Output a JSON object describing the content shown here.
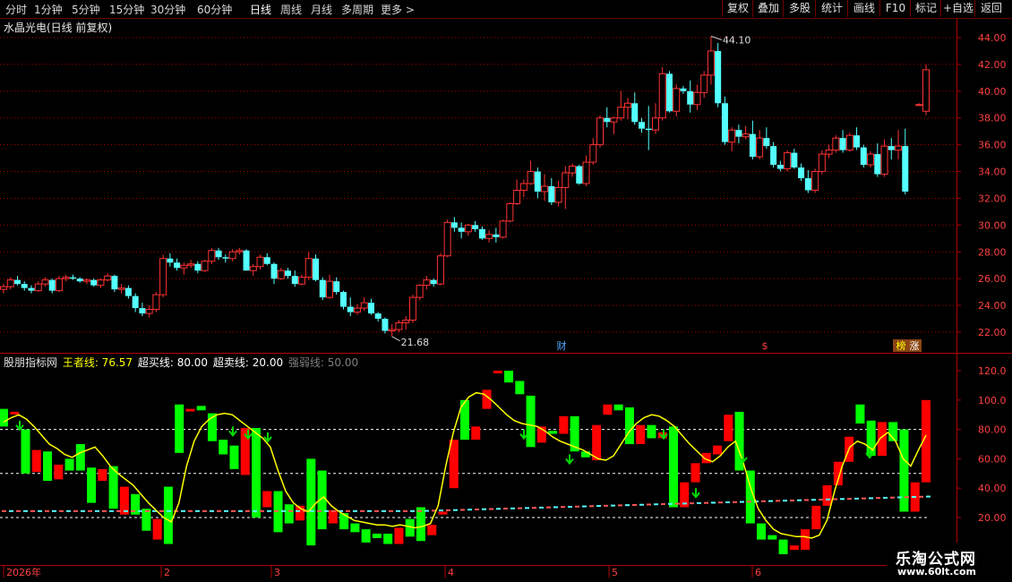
{
  "toolbar": {
    "periods": [
      "分时",
      "1分钟",
      "5分钟",
      "15分钟",
      "30分钟",
      "60分钟",
      "日线",
      "周线",
      "月线",
      "多周期",
      "更多 >"
    ],
    "active_period": "日线",
    "tools": [
      "复权",
      "叠加",
      "多股",
      "统计",
      "画线",
      "F10",
      "标记",
      "+自选",
      "返回"
    ]
  },
  "main_chart": {
    "title": "水晶光电(日线 前复权)",
    "price_axis": [
      "44.00",
      "42.00",
      "40.00",
      "38.00",
      "36.00",
      "34.00",
      "32.00",
      "30.00",
      "28.00",
      "26.00",
      "24.00",
      "22.00"
    ],
    "high_label": "44.10",
    "low_label": "21.68",
    "markers": [
      "财",
      "$",
      "榜",
      "涨"
    ]
  },
  "indicator": {
    "name": "股朋指标网",
    "lines": [
      {
        "label": "王者线:",
        "value": "76.57",
        "color": "#ffff00"
      },
      {
        "label": "超买线:",
        "value": "80.00",
        "color": "#ffffff"
      },
      {
        "label": "超卖线:",
        "value": "20.00",
        "color": "#ffffff"
      },
      {
        "label": "强弱线:",
        "value": "50.00",
        "color": "#808080"
      }
    ],
    "axis": [
      "120.0",
      "100.0",
      "80.00",
      "60.00",
      "40.00",
      "20.00"
    ]
  },
  "date_axis": [
    "2026年",
    "2",
    "3",
    "4",
    "5",
    "6"
  ],
  "watermark": {
    "line1": "乐淘公式网",
    "line2": "www.60lt.com"
  },
  "colors": {
    "up": "#ff3232",
    "down": "#54ffff",
    "ind_up": "#ff0000",
    "ind_down": "#00ff00",
    "king": "#ffff00",
    "grid": "#b00000"
  },
  "chart_data": [
    {
      "type": "candlestick",
      "title": "水晶光电(日线 前复权)",
      "ylim": [
        21.0,
        45.0
      ],
      "annotations": [
        {
          "label": "44.10",
          "type": "high"
        },
        {
          "label": "21.68",
          "type": "low"
        }
      ],
      "ohlc": [
        [
          25.2,
          25.6,
          24.9,
          25.4
        ],
        [
          25.4,
          26.1,
          25.2,
          25.9
        ],
        [
          25.9,
          26.2,
          25.5,
          25.6
        ],
        [
          25.6,
          25.8,
          25.1,
          25.3
        ],
        [
          25.3,
          25.5,
          24.9,
          25.1
        ],
        [
          25.1,
          25.8,
          25.0,
          25.6
        ],
        [
          25.6,
          26.1,
          25.4,
          25.9
        ],
        [
          25.9,
          26.0,
          24.9,
          25.1
        ],
        [
          25.1,
          26.2,
          25.0,
          26.0
        ],
        [
          26.0,
          26.3,
          25.8,
          26.1
        ],
        [
          26.1,
          26.3,
          25.9,
          26.0
        ],
        [
          26.0,
          26.1,
          25.7,
          25.8
        ],
        [
          25.8,
          26.0,
          25.6,
          25.9
        ],
        [
          25.9,
          26.0,
          25.4,
          25.5
        ],
        [
          25.5,
          26.0,
          25.3,
          25.9
        ],
        [
          25.9,
          26.4,
          25.8,
          26.2
        ],
        [
          26.2,
          26.3,
          25.0,
          25.2
        ],
        [
          25.2,
          25.6,
          24.9,
          25.3
        ],
        [
          25.3,
          25.5,
          24.5,
          24.7
        ],
        [
          24.7,
          24.9,
          23.5,
          23.8
        ],
        [
          23.8,
          24.2,
          23.2,
          23.4
        ],
        [
          23.4,
          24.0,
          23.1,
          23.7
        ],
        [
          23.7,
          25.0,
          23.5,
          24.8
        ],
        [
          24.8,
          27.8,
          24.6,
          27.5
        ],
        [
          27.5,
          27.9,
          26.9,
          27.2
        ],
        [
          27.2,
          27.5,
          26.6,
          26.8
        ],
        [
          26.8,
          27.2,
          26.3,
          27.0
        ],
        [
          27.0,
          27.4,
          26.8,
          27.1
        ],
        [
          27.1,
          27.3,
          26.4,
          26.6
        ],
        [
          26.6,
          27.4,
          26.5,
          27.3
        ],
        [
          27.3,
          28.3,
          27.1,
          28.1
        ],
        [
          28.1,
          28.3,
          27.4,
          27.6
        ],
        [
          27.6,
          27.8,
          27.2,
          27.5
        ],
        [
          27.5,
          28.2,
          27.3,
          28.0
        ],
        [
          28.0,
          28.3,
          27.8,
          28.1
        ],
        [
          28.1,
          28.2,
          26.6,
          26.6
        ],
        [
          26.6,
          27.1,
          26.2,
          26.9
        ],
        [
          26.9,
          27.8,
          26.7,
          27.6
        ],
        [
          27.6,
          27.9,
          27.0,
          27.1
        ],
        [
          27.1,
          27.2,
          25.6,
          26.0
        ],
        [
          26.0,
          26.8,
          25.9,
          26.6
        ],
        [
          26.6,
          26.8,
          26.0,
          26.2
        ],
        [
          26.2,
          26.6,
          25.4,
          25.6
        ],
        [
          25.6,
          26.3,
          25.5,
          26.1
        ],
        [
          26.1,
          28.0,
          25.9,
          27.5
        ],
        [
          27.5,
          27.8,
          25.8,
          25.9
        ],
        [
          25.9,
          26.1,
          24.4,
          24.6
        ],
        [
          24.6,
          26.3,
          24.5,
          25.8
        ],
        [
          25.8,
          26.1,
          24.8,
          25.0
        ],
        [
          25.0,
          25.1,
          23.7,
          23.9
        ],
        [
          23.9,
          24.6,
          23.2,
          23.5
        ],
        [
          23.5,
          24.1,
          23.3,
          23.8
        ],
        [
          23.8,
          24.6,
          23.6,
          24.2
        ],
        [
          24.2,
          24.5,
          23.3,
          23.4
        ],
        [
          23.4,
          23.5,
          22.8,
          23.0
        ],
        [
          23.0,
          23.1,
          21.9,
          22.1
        ],
        [
          22.1,
          22.6,
          21.68,
          22.2
        ],
        [
          22.2,
          22.9,
          22.0,
          22.7
        ],
        [
          22.7,
          23.2,
          22.2,
          22.9
        ],
        [
          22.9,
          24.8,
          22.7,
          24.6
        ],
        [
          24.6,
          25.6,
          24.4,
          25.5
        ],
        [
          25.5,
          26.2,
          25.2,
          25.9
        ],
        [
          25.9,
          26.0,
          25.4,
          25.6
        ],
        [
          25.6,
          27.9,
          25.5,
          27.7
        ],
        [
          27.7,
          30.4,
          27.6,
          30.2
        ],
        [
          30.2,
          30.6,
          29.5,
          29.8
        ],
        [
          29.8,
          30.2,
          29.0,
          29.5
        ],
        [
          29.5,
          30.1,
          29.2,
          30.0
        ],
        [
          30.0,
          30.3,
          29.5,
          29.7
        ],
        [
          29.7,
          29.9,
          28.9,
          29.0
        ],
        [
          29.0,
          29.6,
          28.7,
          29.3
        ],
        [
          29.3,
          29.8,
          28.7,
          29.1
        ],
        [
          29.1,
          30.4,
          29.0,
          30.3
        ],
        [
          30.3,
          31.7,
          30.2,
          31.6
        ],
        [
          31.6,
          33.4,
          31.5,
          32.6
        ],
        [
          32.6,
          33.4,
          32.1,
          33.1
        ],
        [
          33.1,
          34.8,
          33.0,
          34.0
        ],
        [
          34.0,
          34.3,
          32.0,
          32.5
        ],
        [
          32.5,
          33.8,
          31.8,
          32.9
        ],
        [
          32.9,
          33.5,
          31.5,
          31.7
        ],
        [
          31.7,
          33.3,
          31.4,
          32.8
        ],
        [
          32.8,
          34.4,
          31.2,
          33.9
        ],
        [
          33.9,
          34.6,
          33.6,
          34.4
        ],
        [
          34.4,
          34.5,
          33.0,
          33.1
        ],
        [
          33.1,
          35.2,
          32.9,
          34.7
        ],
        [
          34.7,
          36.5,
          34.5,
          36.0
        ],
        [
          36.0,
          38.2,
          35.8,
          38.0
        ],
        [
          38.0,
          38.8,
          37.3,
          37.7
        ],
        [
          37.7,
          38.1,
          36.8,
          38.0
        ],
        [
          38.0,
          40.0,
          37.8,
          38.8
        ],
        [
          38.8,
          39.5,
          37.9,
          39.1
        ],
        [
          39.1,
          39.9,
          37.5,
          37.7
        ],
        [
          37.7,
          38.0,
          36.9,
          37.2
        ],
        [
          37.2,
          38.9,
          35.6,
          37.1
        ],
        [
          37.1,
          39.1,
          36.8,
          38.0
        ],
        [
          38.0,
          41.8,
          37.8,
          41.3
        ],
        [
          41.3,
          41.5,
          38.4,
          38.5
        ],
        [
          38.5,
          40.5,
          38.1,
          40.2
        ],
        [
          40.2,
          40.4,
          39.8,
          40.0
        ],
        [
          40.0,
          40.8,
          38.4,
          39.0
        ],
        [
          39.0,
          40.5,
          38.6,
          39.9
        ],
        [
          39.9,
          41.5,
          39.5,
          41.2
        ],
        [
          41.2,
          44.1,
          40.5,
          43.0
        ],
        [
          43.0,
          43.6,
          38.8,
          39.1
        ],
        [
          39.1,
          39.6,
          36.0,
          36.2
        ],
        [
          36.2,
          37.3,
          35.5,
          37.1
        ],
        [
          37.1,
          37.5,
          36.1,
          36.6
        ],
        [
          36.6,
          37.4,
          36.4,
          36.8
        ],
        [
          36.8,
          37.8,
          34.9,
          35.1
        ],
        [
          35.1,
          37.1,
          34.9,
          36.5
        ],
        [
          36.5,
          37.3,
          35.7,
          35.9
        ],
        [
          35.9,
          36.2,
          34.3,
          34.5
        ],
        [
          34.5,
          34.8,
          34.0,
          34.2
        ],
        [
          34.2,
          35.6,
          34.0,
          35.4
        ],
        [
          35.4,
          35.7,
          34.2,
          34.3
        ],
        [
          34.3,
          34.6,
          33.3,
          33.5
        ],
        [
          33.5,
          34.1,
          32.4,
          32.6
        ],
        [
          32.6,
          34.2,
          32.4,
          34.0
        ],
        [
          34.0,
          35.6,
          33.8,
          35.3
        ],
        [
          35.3,
          36.0,
          35.0,
          35.6
        ],
        [
          35.6,
          36.7,
          35.4,
          36.5
        ],
        [
          36.5,
          37.1,
          35.4,
          35.6
        ],
        [
          35.6,
          36.9,
          35.5,
          36.7
        ],
        [
          36.7,
          37.3,
          35.6,
          35.8
        ],
        [
          35.8,
          36.0,
          34.3,
          34.5
        ],
        [
          34.5,
          35.5,
          34.3,
          35.3
        ],
        [
          35.3,
          36.1,
          33.6,
          33.8
        ],
        [
          33.8,
          36.4,
          33.6,
          35.9
        ],
        [
          35.9,
          36.5,
          34.9,
          35.6
        ],
        [
          35.6,
          37.1,
          34.9,
          35.9
        ],
        [
          35.9,
          37.2,
          32.3,
          32.5
        ],
        [
          null,
          null,
          null,
          null
        ],
        [
          39.0,
          39.1,
          38.9,
          39.0
        ],
        [
          38.5,
          42.0,
          38.2,
          41.6
        ]
      ]
    },
    {
      "type": "indicator",
      "title": "股朋指标网",
      "ylim": [
        10,
        125
      ],
      "series": [
        {
          "name": "王者线",
          "value": 76.57
        },
        {
          "name": "超买线",
          "value": 80.0
        },
        {
          "name": "超卖线",
          "value": 20.0
        },
        {
          "name": "强弱线",
          "value": 50.0
        }
      ],
      "king": [
        85,
        88,
        90,
        87,
        82,
        76,
        70,
        67,
        63,
        61,
        64,
        66,
        68,
        62,
        55,
        50,
        46,
        42,
        36,
        30,
        25,
        20,
        17,
        30,
        55,
        72,
        82,
        87,
        90,
        91,
        90,
        86,
        82,
        78,
        74,
        68,
        52,
        38,
        30,
        26,
        24,
        30,
        34,
        28,
        24,
        21,
        18,
        17,
        16,
        15,
        15,
        14,
        15,
        14,
        13,
        14,
        16,
        28,
        55,
        78,
        95,
        102,
        105,
        104,
        100,
        95,
        90,
        86,
        84,
        83,
        82,
        79,
        75,
        72,
        70,
        68,
        66,
        63,
        60,
        59,
        62,
        70,
        78,
        84,
        88,
        90,
        89,
        86,
        82,
        76,
        70,
        65,
        60,
        58,
        62,
        68,
        72,
        58,
        40,
        26,
        18,
        12,
        9,
        8,
        7,
        7,
        6,
        8,
        18,
        38,
        55,
        68,
        72,
        70,
        66,
        74,
        78,
        72,
        60,
        55,
        66,
        76
      ],
      "bars": [
        [
          94,
          82
        ],
        [
          92,
          92
        ],
        [
          80,
          50
        ],
        [
          51,
          66
        ],
        [
          65,
          45
        ],
        [
          46,
          56
        ],
        [
          60,
          52
        ],
        [
          70,
          52
        ],
        [
          54,
          30
        ],
        [
          45,
          53
        ],
        [
          55,
          26
        ],
        [
          22,
          41
        ],
        [
          36,
          22
        ],
        [
          26,
          11
        ],
        [
          5,
          19
        ],
        [
          41,
          2
        ],
        [
          97,
          64
        ],
        [
          94,
          94
        ],
        [
          96,
          93
        ],
        [
          91,
          72
        ],
        [
          73,
          63
        ],
        [
          69,
          53
        ],
        [
          49,
          81
        ],
        [
          81,
          20
        ],
        [
          27,
          38
        ],
        [
          38,
          10
        ],
        [
          29,
          16
        ],
        [
          18,
          28
        ],
        [
          60,
          1
        ],
        [
          52,
          12
        ],
        [
          16,
          25
        ],
        [
          23,
          12
        ],
        [
          16,
          10
        ],
        [
          12,
          3
        ],
        [
          9,
          6
        ],
        [
          9,
          2
        ],
        [
          2,
          13
        ],
        [
          19,
          7
        ],
        [
          27,
          4
        ],
        [
          8,
          15
        ],
        [
          22,
          24
        ],
        [
          40,
          73
        ],
        [
          100,
          73
        ],
        [
          73,
          82
        ],
        [
          94,
          107
        ],
        [
          120,
          120
        ],
        [
          120,
          112
        ],
        [
          113,
          104
        ],
        [
          103,
          68
        ],
        [
          71,
          82
        ],
        [
          79,
          77
        ],
        [
          77,
          89
        ],
        [
          89,
          65
        ],
        [
          65,
          61
        ],
        [
          59,
          83
        ],
        [
          90,
          97
        ],
        [
          97,
          93
        ],
        [
          95,
          70
        ],
        [
          70,
          83
        ],
        [
          83,
          74
        ],
        [
          74,
          78
        ],
        [
          82,
          27
        ],
        [
          27,
          44
        ],
        [
          44,
          57
        ],
        [
          57,
          64
        ],
        [
          63,
          69
        ],
        [
          72,
          90
        ],
        [
          92,
          52
        ],
        [
          52,
          16
        ],
        [
          16,
          5
        ],
        [
          8,
          5
        ],
        [
          5,
          -5
        ],
        [
          -2,
          1
        ],
        [
          -2,
          12
        ],
        [
          12,
          28
        ],
        [
          28,
          42
        ],
        [
          42,
          58
        ],
        [
          58,
          75
        ],
        [
          97,
          84
        ],
        [
          86,
          62
        ],
        [
          62,
          85
        ],
        [
          85,
          72
        ],
        [
          80,
          24
        ],
        [
          24,
          44
        ],
        [
          44,
          100
        ]
      ]
    }
  ]
}
